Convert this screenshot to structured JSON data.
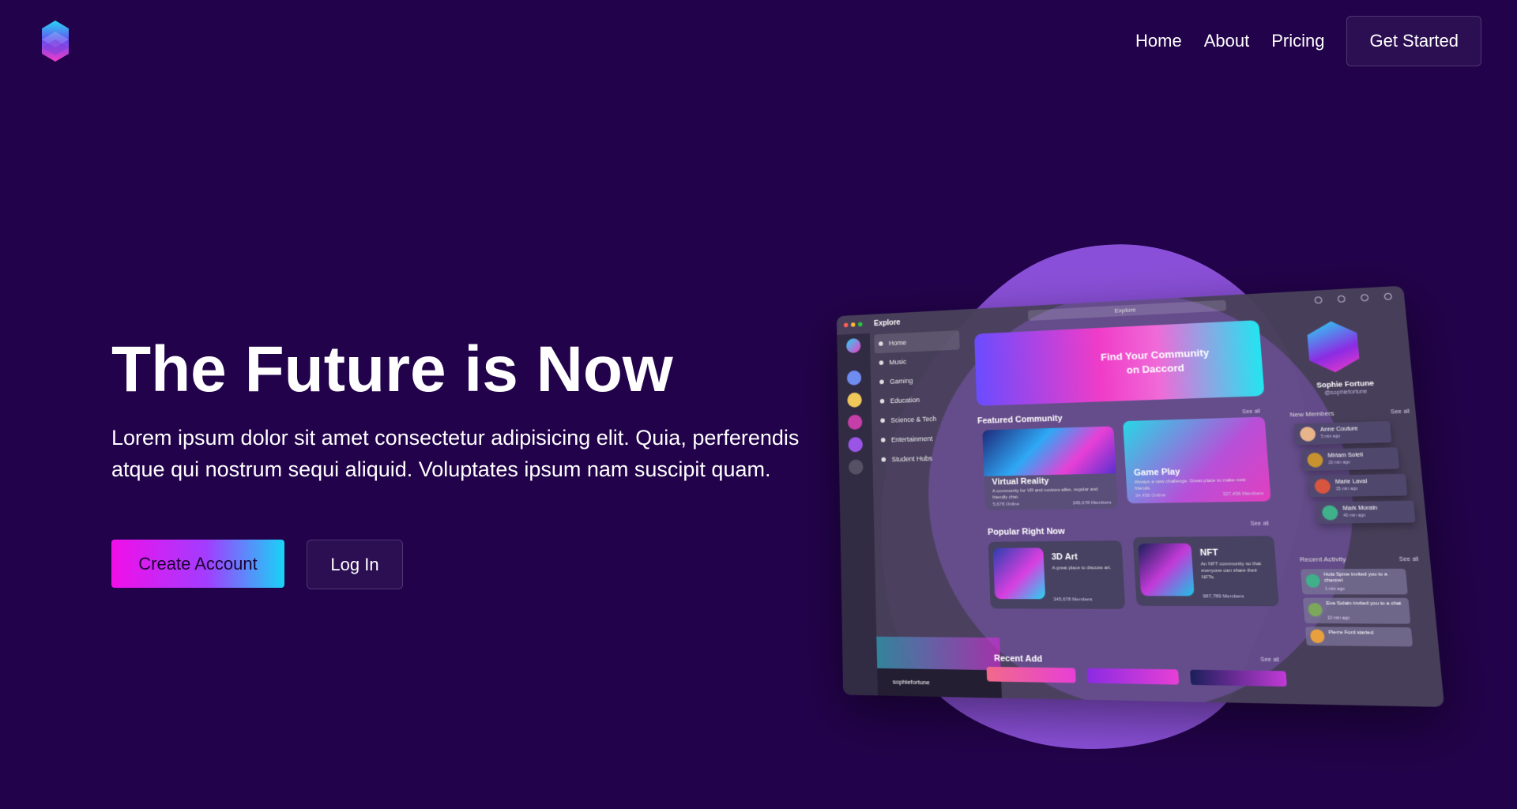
{
  "header": {
    "logo_icon": "hexagon-logo-icon",
    "nav": [
      {
        "label": "Home"
      },
      {
        "label": "About"
      },
      {
        "label": "Pricing"
      }
    ],
    "cta_label": "Get Started"
  },
  "hero": {
    "title": "The Future is Now",
    "description": "Lorem ipsum dolor sit amet consectetur adipisicing elit. Quia, perferendis atque qui nostrum sequi aliquid. Voluptates ipsum nam suscipit quam.",
    "primary_label": "Create Account",
    "secondary_label": "Log In"
  },
  "colors": {
    "background": "#22024a",
    "primary_gradient_start": "#f20ee8",
    "primary_gradient_end": "#18d3f6",
    "secondary_button": "#2b0f52",
    "blob": "#8a4fd8"
  },
  "mockup": {
    "window_title": "Explore",
    "search_placeholder": "Explore",
    "sidebar": [
      {
        "label": "Home",
        "icon": "compass-icon"
      },
      {
        "label": "Music",
        "icon": "music-note-icon"
      },
      {
        "label": "Gaming",
        "icon": "gamepad-icon"
      },
      {
        "label": "Education",
        "icon": "graduation-cap-icon"
      },
      {
        "label": "Science & Tech",
        "icon": "atom-icon"
      },
      {
        "label": "Entertainment",
        "icon": "film-icon"
      },
      {
        "label": "Student Hubs",
        "icon": "building-icon"
      }
    ],
    "banner_line1": "Find Your Community",
    "banner_line2": "on Daccord",
    "featured_heading": "Featured Community",
    "featured": [
      {
        "title": "Virtual Reality",
        "desc": "A community for VR and novices alike, regular and friendly chat.",
        "online": "5,678 Online",
        "members": "345,678 Members"
      },
      {
        "title": "Game Play",
        "desc": "Always a new challenge. Great place to make new friends.",
        "online": "34,456 Online",
        "members": "327,456 Members"
      }
    ],
    "popular_heading": "Popular Right Now",
    "popular": [
      {
        "title": "3D Art",
        "desc": "A great place to discuss art.",
        "members": "345,678 Members"
      },
      {
        "title": "NFT",
        "desc": "An NFT community so that everyone can share their NFTs.",
        "members": "987,789 Members"
      }
    ],
    "recent_heading": "Recent Add",
    "see_all": "See all",
    "user_handle": "sophiefortune",
    "profile_name": "Sophie Fortune",
    "profile_handle": "@sophiefortune",
    "members_heading": "New Members",
    "members": [
      {
        "name": "Anne Couture",
        "time": "5 min ago"
      },
      {
        "name": "Miriam Soleil",
        "time": "20 min ago"
      },
      {
        "name": "Marie Laval",
        "time": "35 min ago"
      },
      {
        "name": "Mark Morain",
        "time": "40 min ago"
      }
    ],
    "activity_heading": "Recent Activity",
    "activity": [
      {
        "text": "Hola Spine invited you to a channel",
        "time": "1 min ago"
      },
      {
        "text": "Eva Solain invited you to a chat",
        "time": "10 min ago"
      },
      {
        "text": "Pierre Ford started",
        "time": ""
      }
    ]
  }
}
